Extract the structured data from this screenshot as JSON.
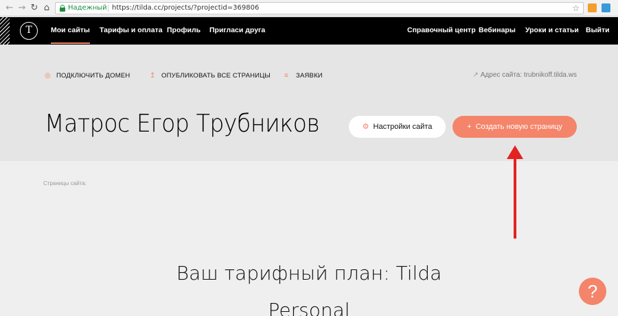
{
  "browser": {
    "secure_label": "Надежный",
    "url": "https://tilda.cc/projects/?projectid=369806"
  },
  "nav": {
    "logo_letter": "T",
    "left": [
      {
        "label": "Мои сайты",
        "active": true
      },
      {
        "label": "Тарифы и оплата"
      },
      {
        "label": "Профиль"
      },
      {
        "label": "Пригласи друга"
      }
    ],
    "right": [
      {
        "label": "Справочный центр"
      },
      {
        "label": "Вебинары"
      },
      {
        "label": "Уроки и статьи"
      },
      {
        "label": "Выйти"
      }
    ]
  },
  "actions": {
    "connect_domain": "ПОДКЛЮЧИТЬ ДОМЕН",
    "publish_all": "ОПУБЛИКОВАТЬ ВСЕ СТРАНИЦЫ",
    "requests": "ЗАЯВКИ"
  },
  "site_address": {
    "label": "Адрес сайта:",
    "value": "trubnikoff.tilda.ws"
  },
  "project": {
    "title": "Матрос Егор Трубников",
    "settings_button": "Настройки сайта",
    "create_page_button": "Создать новую страницу"
  },
  "content": {
    "pages_label": "Страницы сайта:",
    "plan_title": "Ваш тарифный план: Tilda Personal"
  },
  "help": {
    "label": "?"
  },
  "colors": {
    "accent": "#f4846a",
    "nav_bg": "#000000",
    "band_bg": "#e5e5e5",
    "page_bg": "#efefef",
    "annotation_arrow": "#e32222"
  }
}
